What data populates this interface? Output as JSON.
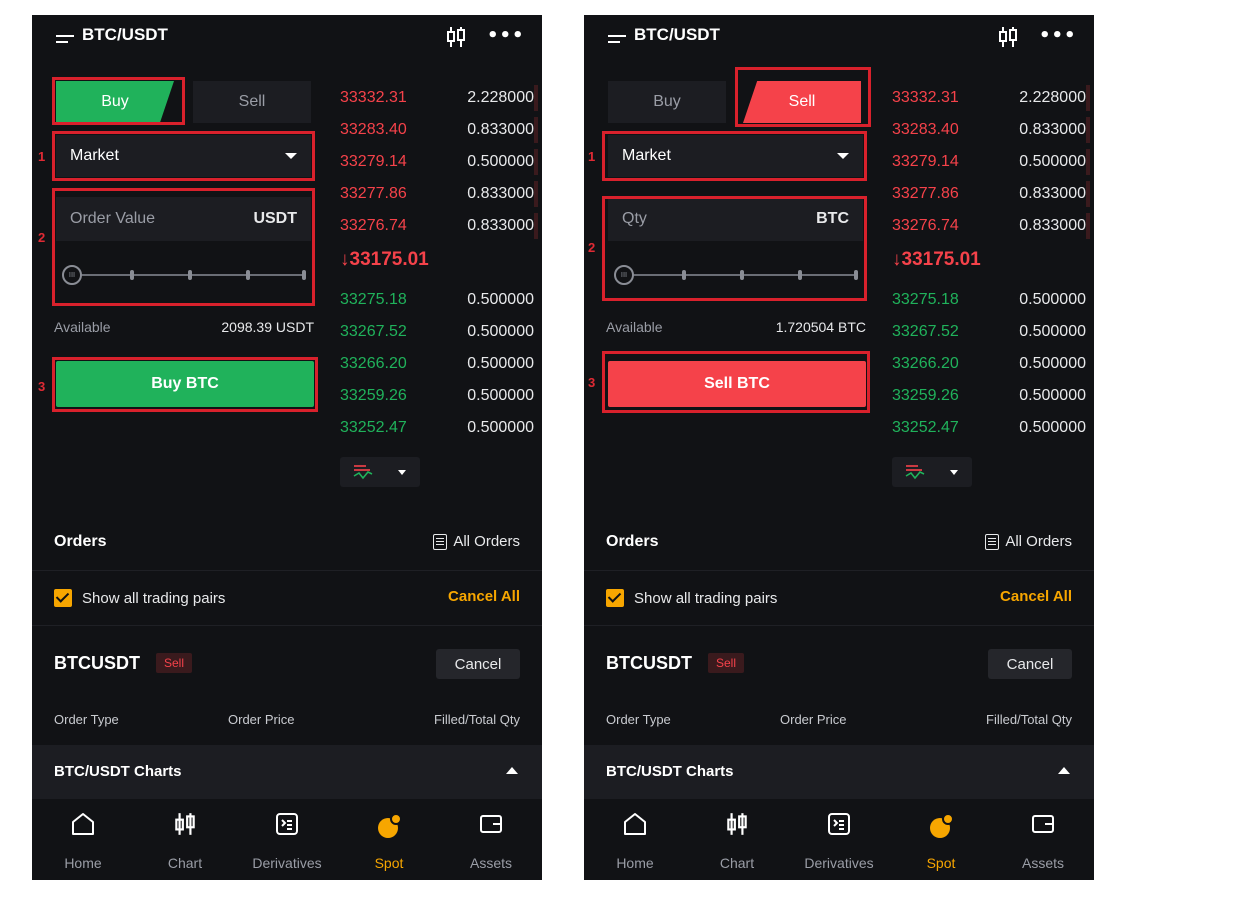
{
  "colors": {
    "buy": "#20b25b",
    "sell": "#f5424a",
    "accent": "#f7a600",
    "background": "#111215",
    "annotation": "#d9212c"
  },
  "icons": {
    "menu": "menu-icon",
    "candle": "candlestick-icon",
    "more": "more-icon",
    "depth": "depth-view-icon",
    "orders": "document-icon",
    "home": "home-icon",
    "chart": "chart-icon",
    "derivatives": "derivatives-icon",
    "spot": "spot-icon",
    "assets": "wallet-icon"
  },
  "screens": [
    {
      "header": {
        "title": "BTC/USDT",
        "more": "•••"
      },
      "form": {
        "buy_label": "Buy",
        "sell_label": "Sell",
        "order_type": "Market",
        "input_placeholder": "Order Value",
        "input_unit": "USDT",
        "available_label": "Available",
        "available_value": "2098.39 USDT",
        "action_label": "Buy BTC",
        "step_labels": [
          "1",
          "2",
          "3"
        ]
      },
      "orderbook": {
        "asks": [
          {
            "price": "33332.31",
            "qty": "2.228000"
          },
          {
            "price": "33283.40",
            "qty": "0.833000"
          },
          {
            "price": "33279.14",
            "qty": "0.500000"
          },
          {
            "price": "33277.86",
            "qty": "0.833000"
          },
          {
            "price": "33276.74",
            "qty": "0.833000"
          }
        ],
        "last_price": "↓33175.01",
        "bids": [
          {
            "price": "33275.18",
            "qty": "0.500000"
          },
          {
            "price": "33267.52",
            "qty": "0.500000"
          },
          {
            "price": "33266.20",
            "qty": "0.500000"
          },
          {
            "price": "33259.26",
            "qty": "0.500000"
          },
          {
            "price": "33252.47",
            "qty": "0.500000"
          }
        ]
      },
      "orders": {
        "title": "Orders",
        "all_orders": "All Orders",
        "show_all_pairs": "Show all trading pairs",
        "show_all_checked": true,
        "cancel_all": "Cancel All",
        "pair": "BTCUSDT",
        "side": "Sell",
        "cancel": "Cancel",
        "columns": [
          "Order Type",
          "Order Price",
          "Filled/Total Qty"
        ]
      },
      "charts_bar": "BTC/USDT Charts",
      "tabs": [
        {
          "label": "Home",
          "active": false
        },
        {
          "label": "Chart",
          "active": false
        },
        {
          "label": "Derivatives",
          "active": false
        },
        {
          "label": "Spot",
          "active": true
        },
        {
          "label": "Assets",
          "active": false
        }
      ]
    },
    {
      "header": {
        "title": "BTC/USDT",
        "more": "•••"
      },
      "form": {
        "buy_label": "Buy",
        "sell_label": "Sell",
        "order_type": "Market",
        "input_placeholder": "Qty",
        "input_unit": "BTC",
        "available_label": "Available",
        "available_value": "1.720504 BTC",
        "action_label": "Sell BTC",
        "step_labels": [
          "1",
          "2",
          "3"
        ]
      },
      "orderbook": {
        "asks": [
          {
            "price": "33332.31",
            "qty": "2.228000"
          },
          {
            "price": "33283.40",
            "qty": "0.833000"
          },
          {
            "price": "33279.14",
            "qty": "0.500000"
          },
          {
            "price": "33277.86",
            "qty": "0.833000"
          },
          {
            "price": "33276.74",
            "qty": "0.833000"
          }
        ],
        "last_price": "↓33175.01",
        "bids": [
          {
            "price": "33275.18",
            "qty": "0.500000"
          },
          {
            "price": "33267.52",
            "qty": "0.500000"
          },
          {
            "price": "33266.20",
            "qty": "0.500000"
          },
          {
            "price": "33259.26",
            "qty": "0.500000"
          },
          {
            "price": "33252.47",
            "qty": "0.500000"
          }
        ]
      },
      "orders": {
        "title": "Orders",
        "all_orders": "All Orders",
        "show_all_pairs": "Show all trading pairs",
        "show_all_checked": true,
        "cancel_all": "Cancel All",
        "pair": "BTCUSDT",
        "side": "Sell",
        "cancel": "Cancel",
        "columns": [
          "Order Type",
          "Order Price",
          "Filled/Total Qty"
        ]
      },
      "charts_bar": "BTC/USDT Charts",
      "tabs": [
        {
          "label": "Home",
          "active": false
        },
        {
          "label": "Chart",
          "active": false
        },
        {
          "label": "Derivatives",
          "active": false
        },
        {
          "label": "Spot",
          "active": true
        },
        {
          "label": "Assets",
          "active": false
        }
      ]
    }
  ]
}
